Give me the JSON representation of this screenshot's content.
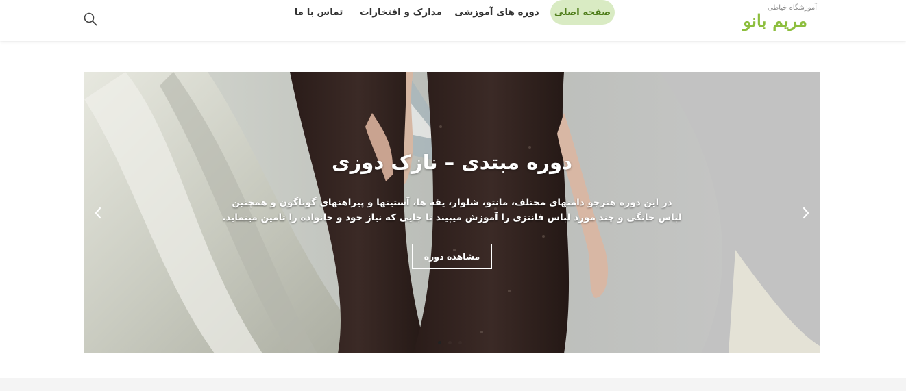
{
  "logo": {
    "small": "آموزشگاه خیاطی",
    "big": "مریم بانو"
  },
  "nav": {
    "items": [
      {
        "label": "صفحه اصلی",
        "active": true
      },
      {
        "label": "دوره های آموزشی",
        "active": false
      },
      {
        "label": "مدارک و افتخارات",
        "active": false
      },
      {
        "label": "تماس با ما",
        "active": false
      }
    ]
  },
  "slider": {
    "title": "دوره مبتدی – نازک دوزی",
    "description_line1": "در این دوره هنرجو دامنهای مختلف، مانتو، شلوار، یقه ها، آستینها و پیراهنهای گوناگون و همچنین",
    "description_line2": "لباس خانگی و چند مورد لباس فانتزی را آموزش میبیند تا جایی که نیاز خود و خانواده را تامین مینماید.",
    "button": "مشاهده دوره",
    "slide_count": 3,
    "active_slide": 1
  },
  "colors": {
    "brand": "#8dbe3e",
    "nav_active_bg": "#d9ebc3"
  },
  "icons": {
    "search": "search-icon",
    "prev": "chevron-left-icon",
    "next": "chevron-right-icon"
  }
}
